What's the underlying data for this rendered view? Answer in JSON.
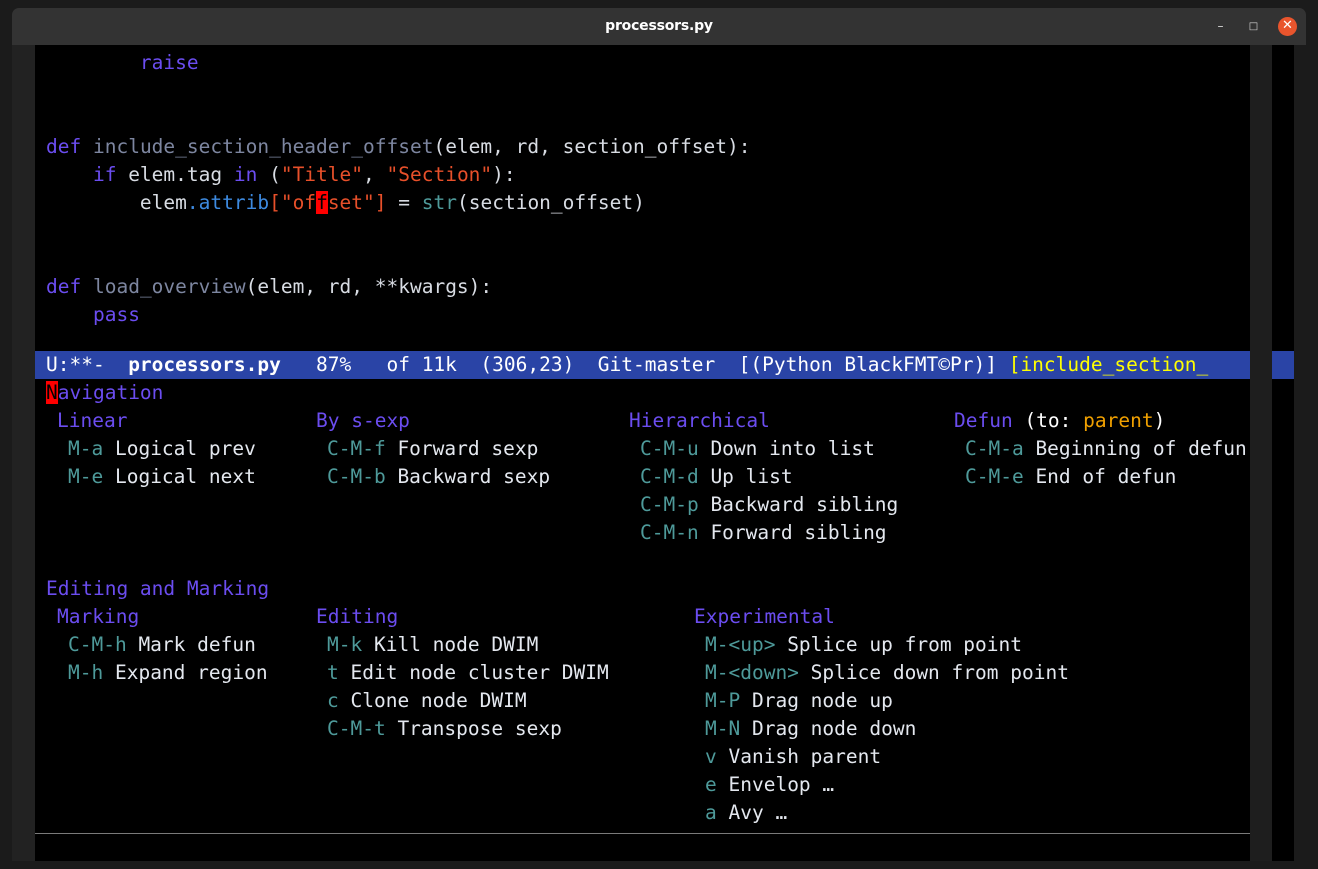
{
  "window": {
    "title": "processors.py",
    "buttons": {
      "minimize": "–",
      "maximize": "□",
      "close": "✕"
    },
    "close_color": "#e9552d",
    "titlebar_color": "#333333"
  },
  "editor": {
    "background": "#000000",
    "code_lines": [
      {
        "id": "line-raise",
        "segments": [
          {
            "text": "        ",
            "kind": "plain"
          },
          {
            "text": "raise",
            "kind": "kw"
          }
        ]
      },
      {
        "id": "line-blank-1",
        "segments": [
          {
            "text": " ",
            "kind": "plain"
          }
        ]
      },
      {
        "id": "line-blank-2",
        "segments": [
          {
            "text": " ",
            "kind": "plain"
          }
        ]
      },
      {
        "id": "line-def-include",
        "segments": [
          {
            "text": "def",
            "kind": "kw"
          },
          {
            "text": " ",
            "kind": "plain"
          },
          {
            "text": "include_section_header_offset",
            "kind": "fn"
          },
          {
            "text": "(elem, rd, section_offset):",
            "kind": "plain"
          }
        ]
      },
      {
        "id": "line-if-tag",
        "segments": [
          {
            "text": "    ",
            "kind": "plain"
          },
          {
            "text": "if",
            "kind": "kw"
          },
          {
            "text": " elem.tag ",
            "kind": "plain"
          },
          {
            "text": "in",
            "kind": "kw"
          },
          {
            "text": " (",
            "kind": "plain"
          },
          {
            "text": "\"Title\"",
            "kind": "str"
          },
          {
            "text": ", ",
            "kind": "plain"
          },
          {
            "text": "\"Section\"",
            "kind": "str"
          },
          {
            "text": "):",
            "kind": "plain"
          }
        ]
      },
      {
        "id": "line-attrib-offset",
        "segments": [
          {
            "text": "        elem",
            "kind": "plain"
          },
          {
            "text": ".attrib",
            "kind": "ident"
          },
          {
            "text": "[",
            "kind": "str"
          },
          {
            "text": "\"of",
            "kind": "str"
          },
          {
            "text": "f",
            "kind": "cursor-red"
          },
          {
            "text": "set\"",
            "kind": "str"
          },
          {
            "text": "]",
            "kind": "str"
          },
          {
            "text": " = ",
            "kind": "plain"
          },
          {
            "text": "str",
            "kind": "builtin"
          },
          {
            "text": "(section_offset)",
            "kind": "plain"
          }
        ]
      },
      {
        "id": "line-blank-3",
        "segments": [
          {
            "text": " ",
            "kind": "plain"
          }
        ]
      },
      {
        "id": "line-blank-4",
        "segments": [
          {
            "text": " ",
            "kind": "plain"
          }
        ]
      },
      {
        "id": "line-def-load-overview",
        "segments": [
          {
            "text": "def",
            "kind": "kw"
          },
          {
            "text": " ",
            "kind": "plain"
          },
          {
            "text": "load_overview",
            "kind": "fn"
          },
          {
            "text": "(elem, rd, **kwargs):",
            "kind": "plain"
          }
        ]
      },
      {
        "id": "line-pass",
        "segments": [
          {
            "text": "    ",
            "kind": "plain"
          },
          {
            "text": "pass",
            "kind": "kw"
          }
        ]
      }
    ]
  },
  "modeline": {
    "background": "#2a44a6",
    "encoding": "U:**-",
    "buffer_name": "processors.py",
    "percent": "87%",
    "of_size": "of 11k",
    "position": "(306,23)",
    "vc_state": "Git-master",
    "major_modes": "[(Python BlackFMT©Pr)]",
    "function_context": "[include_section_",
    "function_color": "#ffff00",
    "full_text": "U:**-  processors.py   87%   of 11k  (306,23)  Git-master  [(Python BlackFMT©Pr)] [include_section_"
  },
  "help_panel": {
    "cursor_char": "N",
    "sections": [
      {
        "id": "navigation",
        "title": "Navigation",
        "title_has_cursor": true,
        "columns": [
          {
            "id": "linear",
            "heading": "Linear",
            "heading_suffix": "",
            "bindings": [
              {
                "key": "M-a",
                "desc": "Logical prev"
              },
              {
                "key": "M-e",
                "desc": "Logical next"
              }
            ]
          },
          {
            "id": "by-s-exp",
            "heading": "By s-exp",
            "heading_suffix": "",
            "bindings": [
              {
                "key": "C-M-f",
                "desc": "Forward sexp"
              },
              {
                "key": "C-M-b",
                "desc": "Backward sexp"
              }
            ]
          },
          {
            "id": "hierarchical",
            "heading": "Hierarchical",
            "heading_suffix": "",
            "bindings": [
              {
                "key": "C-M-u",
                "desc": "Down into list"
              },
              {
                "key": "C-M-d",
                "desc": "Up list"
              },
              {
                "key": "C-M-p",
                "desc": "Backward sibling"
              },
              {
                "key": "C-M-n",
                "desc": "Forward sibling"
              }
            ]
          },
          {
            "id": "defun",
            "heading": "Defun",
            "heading_suffix": " (to: parent)",
            "suffix_pre": " (to: ",
            "suffix_arg": "parent",
            "suffix_post": ")",
            "bindings": [
              {
                "key": "C-M-a",
                "desc": "Beginning of defun"
              },
              {
                "key": "C-M-e",
                "desc": "End of defun"
              }
            ]
          }
        ]
      },
      {
        "id": "editing-and-marking",
        "title": "Editing and Marking",
        "title_has_cursor": false,
        "columns": [
          {
            "id": "marking",
            "heading": "Marking",
            "heading_suffix": "",
            "bindings": [
              {
                "key": "C-M-h",
                "desc": "Mark defun"
              },
              {
                "key": "M-h",
                "desc": "Expand region"
              }
            ]
          },
          {
            "id": "editing",
            "heading": "Editing",
            "heading_suffix": "",
            "bindings": [
              {
                "key": "M-k",
                "desc": "Kill node DWIM"
              },
              {
                "key": "t",
                "desc": "Edit node cluster DWIM"
              },
              {
                "key": "c",
                "desc": "Clone node DWIM"
              },
              {
                "key": "C-M-t",
                "desc": "Transpose sexp"
              }
            ]
          },
          {
            "id": "experimental",
            "heading": "Experimental",
            "heading_suffix": "",
            "bindings": [
              {
                "key": "M-<up>",
                "desc": "Splice up from point"
              },
              {
                "key": "M-<down>",
                "desc": "Splice down from point"
              },
              {
                "key": "M-P",
                "desc": "Drag node up"
              },
              {
                "key": "M-N",
                "desc": "Drag node down"
              },
              {
                "key": "v",
                "desc": "Vanish parent"
              },
              {
                "key": "e",
                "desc": "Envelop …"
              },
              {
                "key": "a",
                "desc": "Avy …"
              }
            ]
          }
        ]
      }
    ]
  },
  "colors": {
    "keyword": "#6b4df0",
    "string": "#e8502a",
    "function": "#7d86a0",
    "identifier": "#3d8ae0",
    "builtin": "#4e9a9a",
    "key_binding": "#4e9a9a",
    "group_heading": "#6b4df0",
    "description": "#e4e8ef",
    "cursor": "#ff0000",
    "modeline_bg": "#2a44a6"
  }
}
